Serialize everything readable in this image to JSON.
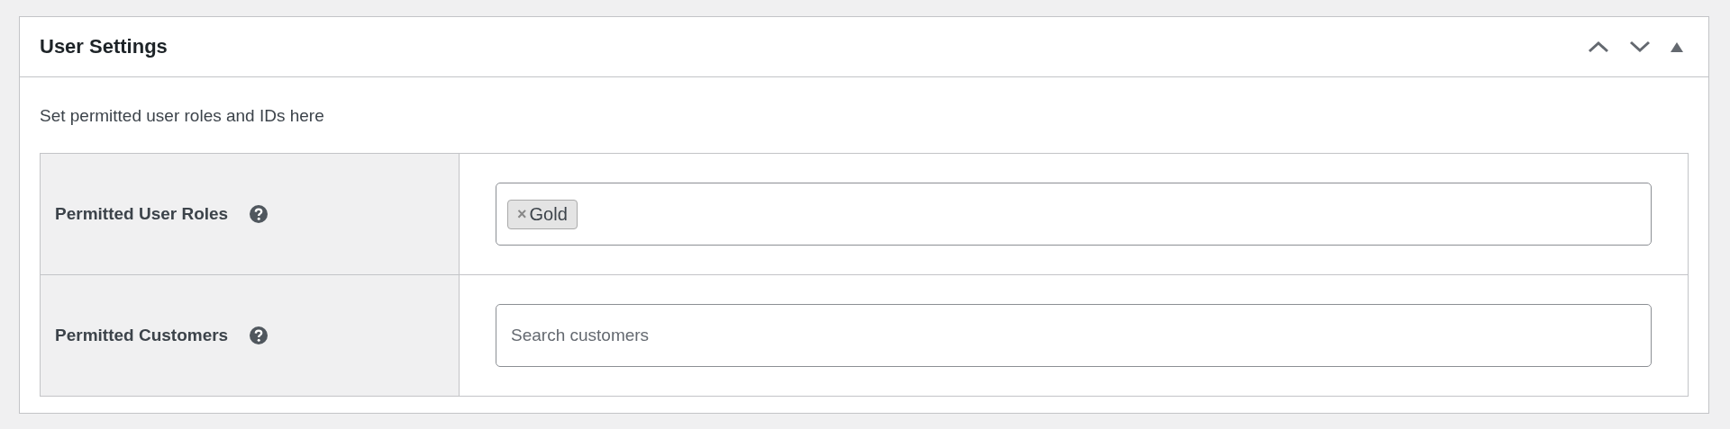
{
  "panel": {
    "title": "User Settings",
    "expanded": true
  },
  "description": "Set permitted user roles and IDs here",
  "rows": [
    {
      "label": "Permitted User Roles",
      "kind": "tags",
      "tags": [
        {
          "remove": "×",
          "label": "Gold"
        }
      ]
    },
    {
      "label": "Permitted Customers",
      "kind": "search",
      "placeholder": "Search customers"
    }
  ]
}
